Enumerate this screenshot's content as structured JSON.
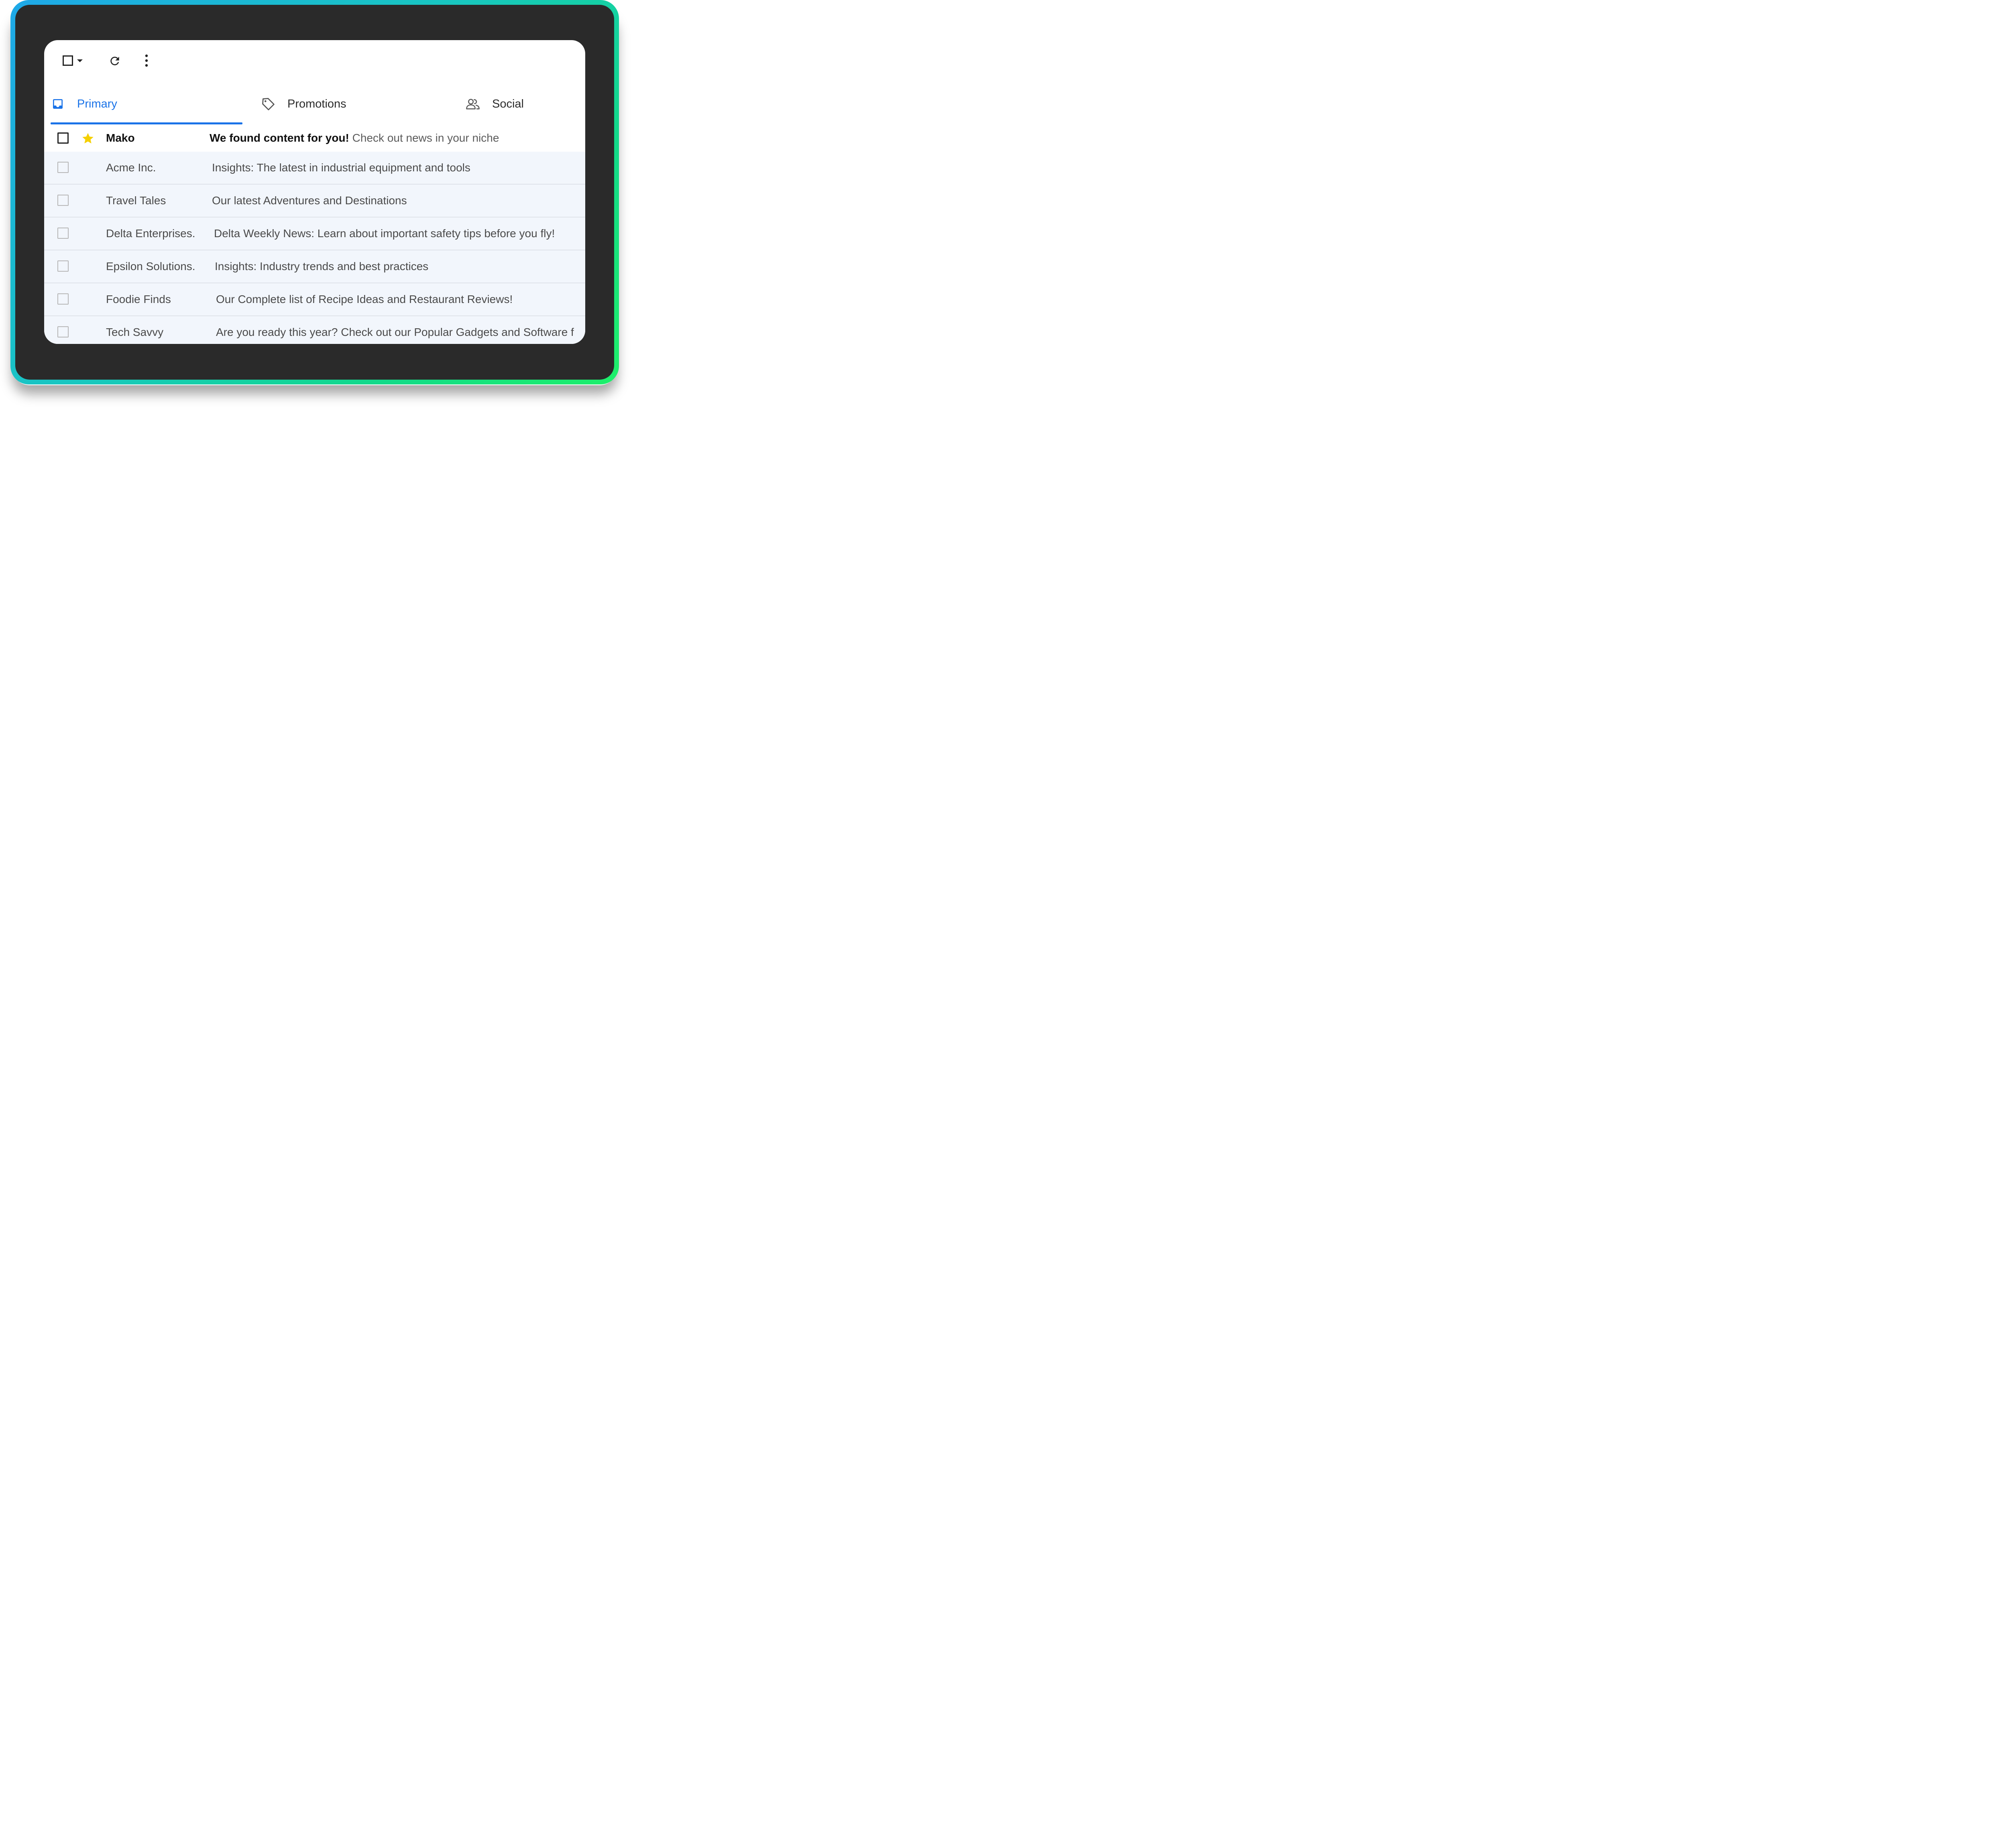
{
  "toolbar": {
    "icons": [
      "checkbox-icon",
      "caret-down-icon",
      "refresh-icon",
      "more-vert-icon"
    ]
  },
  "tabs": [
    {
      "label": "Primary",
      "icon": "inbox-icon",
      "selected": true,
      "color": "#1a73e8"
    },
    {
      "label": "Promotions",
      "icon": "tag-icon",
      "selected": false
    },
    {
      "label": "Social",
      "icon": "people-icon",
      "selected": false
    }
  ],
  "emails": [
    {
      "sender": "Mako",
      "subject_bold": "We found content for you!",
      "subject": " Check out news in your niche",
      "unread": true,
      "starred": true
    },
    {
      "sender": "Acme Inc.",
      "subject": "Insights: The latest in industrial equipment and tools",
      "unread": false
    },
    {
      "sender": "Travel Tales",
      "subject": "Our latest Adventures and Destinations",
      "unread": false
    },
    {
      "sender": "Delta Enterprises.",
      "subject": "Delta Weekly News: Learn about important safety tips before you fly!",
      "unread": false
    },
    {
      "sender": "Epsilon Solutions.",
      "subject": "Insights: Industry trends and best practices",
      "unread": false
    },
    {
      "sender": "Foodie Finds",
      "subject": "Our Complete list of Recipe Ideas and Restaurant Reviews!",
      "unread": false
    },
    {
      "sender": "Tech Savvy",
      "subject": "Are you ready this year? Check out our Popular Gadgets and Software f",
      "unread": false
    }
  ],
  "colors": {
    "accent": "#1a73e8",
    "star": "#f5d000",
    "read_row_bg": "#f2f6fc",
    "frame_bg": "#2a2a2a"
  }
}
